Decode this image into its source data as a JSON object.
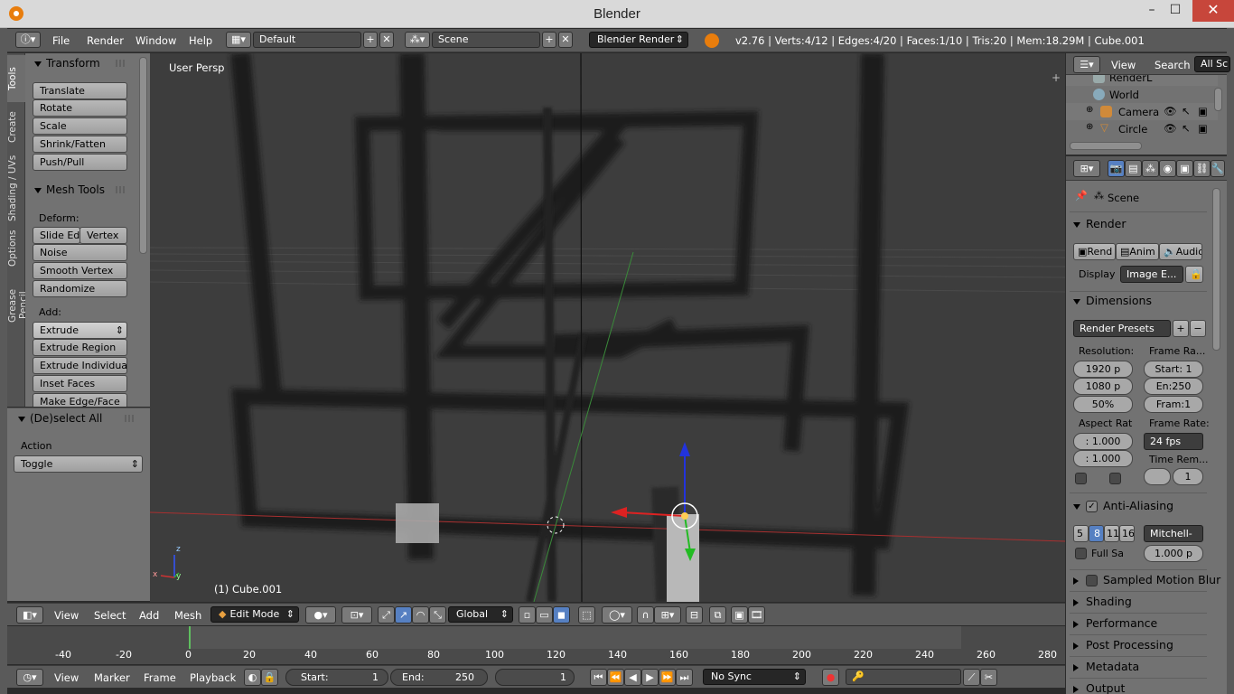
{
  "window": {
    "title": "Blender",
    "min": "–",
    "max": "☐",
    "close": "✕"
  },
  "info": {
    "menus": [
      "File",
      "Render",
      "Window",
      "Help"
    ],
    "layout": "Default",
    "scene": "Scene",
    "engine": "Blender Render",
    "stats": "v2.76 | Verts:4/12 | Edges:4/20 | Faces:1/10 | Tris:20 | Mem:18.29M | Cube.001"
  },
  "toolshelf": {
    "tabs": [
      "Tools",
      "Create",
      "Shading / UVs",
      "Options",
      "Grease Pencil"
    ],
    "transform": {
      "title": "Transform",
      "buttons": [
        "Translate",
        "Rotate",
        "Scale",
        "Shrink/Fatten",
        "Push/Pull"
      ]
    },
    "meshtools": {
      "title": "Mesh Tools",
      "deform_label": "Deform:",
      "slide_edge": "Slide Ed",
      "vertex": "Vertex",
      "deform_buttons": [
        "Noise",
        "Smooth Vertex",
        "Randomize"
      ],
      "add_label": "Add:",
      "extrude": "Extrude",
      "add_buttons": [
        "Extrude Region",
        "Extrude Individual",
        "Inset Faces",
        "Make Edge/Face"
      ]
    }
  },
  "redo": {
    "title": "(De)select All",
    "action_label": "Action",
    "action_value": "Toggle"
  },
  "viewport": {
    "view_label": "User Persp",
    "object_label": "(1) Cube.001",
    "axis_z": "z",
    "axis_y": "y",
    "axis_x": "x"
  },
  "vp_header": {
    "menus": [
      "View",
      "Select",
      "Add",
      "Mesh"
    ],
    "mode": "Edit Mode",
    "orientation": "Global"
  },
  "timeline": {
    "ticks": [
      "-40",
      "-20",
      "0",
      "20",
      "40",
      "60",
      "80",
      "100",
      "120",
      "140",
      "160",
      "180",
      "200",
      "220",
      "240",
      "260",
      "280"
    ],
    "menus": [
      "View",
      "Marker",
      "Frame",
      "Playback"
    ],
    "start_label": "Start:",
    "start_value": "1",
    "end_label": "End:",
    "end_value": "250",
    "current": "1",
    "sync": "No Sync"
  },
  "outliner": {
    "menus": [
      "View",
      "Search"
    ],
    "filter": "All Sc",
    "items": [
      "RenderL",
      "World",
      "Camera",
      "Circle"
    ]
  },
  "properties": {
    "context": "Scene",
    "render": {
      "title": "Render",
      "render_btn": "Rend",
      "anim_btn": "Anim",
      "audio_btn": "Audio",
      "display_label": "Display",
      "display_value": "Image E..."
    },
    "dimensions": {
      "title": "Dimensions",
      "presets": "Render Presets",
      "resolution_label": "Resolution:",
      "res_x": "1920 p",
      "res_y": "1080 p",
      "res_pct": "50%",
      "framerange_label": "Frame Ra...",
      "frame_start": "Start: 1",
      "frame_end": "En:250",
      "frame_step": "Fram:1",
      "aspect_label": "Aspect Rat",
      "aspect_x": ": 1.000",
      "aspect_y": ": 1.000",
      "framerate_label": "Frame Rate:",
      "framerate": "24 fps",
      "timeremap_label": "Time Rem...",
      "timeremap": "1"
    },
    "antialiasing": {
      "title": "Anti-Aliasing",
      "samples": [
        "5",
        "8",
        "11",
        "16"
      ],
      "filter": "Mitchell-",
      "fullsample": "Full Sa",
      "size": "1.000 p"
    },
    "collapsed": [
      "Sampled Motion Blur",
      "Shading",
      "Performance",
      "Post Processing",
      "Metadata",
      "Output"
    ]
  },
  "colors": {
    "accent": "#5680c2",
    "header": "#5a5a5a",
    "panel": "#727272",
    "viewport": "#3d3d3d",
    "close": "#c7463b"
  }
}
